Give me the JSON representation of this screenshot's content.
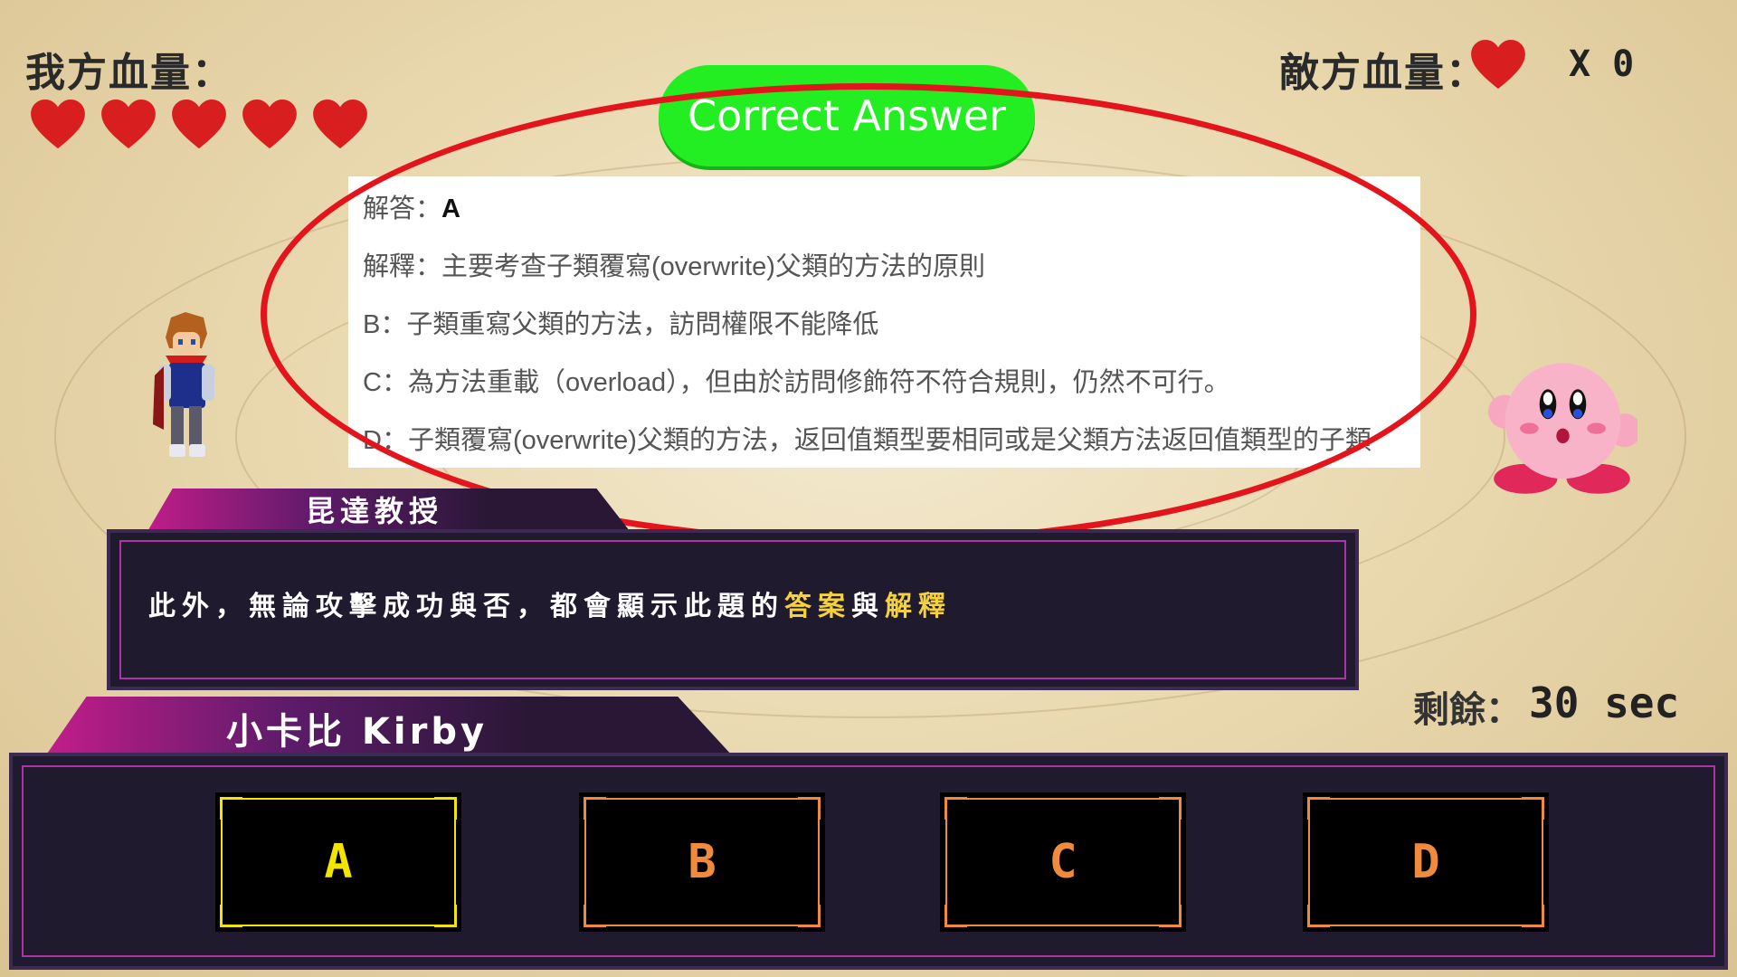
{
  "hud": {
    "player_hp_label": "我方血量：",
    "player_hearts": 5,
    "enemy_hp_label": "敵方血量：",
    "enemy_count": "X 0",
    "heart_color": "#d81e1e"
  },
  "result_badge": "Correct Answer",
  "explanation": {
    "answer_prefix": "解答：",
    "answer_value": "A",
    "lines": [
      "解釋：主要考查子類覆寫(overwrite)父類的方法的原則",
      "B：子類重寫父類的方法，訪問權限不能降低",
      "C：為方法重載（overload），但由於訪問修飾符不符合規則，仍然不可行。",
      "D：子類覆寫(overwrite)父類的方法，返回值類型要相同或是父類方法返回值類型的子類"
    ]
  },
  "dialog": {
    "speaker": "昆達教授",
    "text_before": "此外，無論攻擊成功與否，都會顯示此題的",
    "highlight1": "答案",
    "text_mid": "與",
    "highlight2": "解釋"
  },
  "timer": {
    "label": "剩餘：",
    "value": "30 sec"
  },
  "player_name": "小卡比 Kirby",
  "answers": [
    {
      "label": "A",
      "color": "#f3e500"
    },
    {
      "label": "B",
      "color": "#f08a3c"
    },
    {
      "label": "C",
      "color": "#f08a3c"
    },
    {
      "label": "D",
      "color": "#f08a3c"
    }
  ],
  "colors": {
    "badge_green": "#22ee22",
    "highlight_yellow": "#f5d13b",
    "ellipse_red": "#e3141c"
  }
}
